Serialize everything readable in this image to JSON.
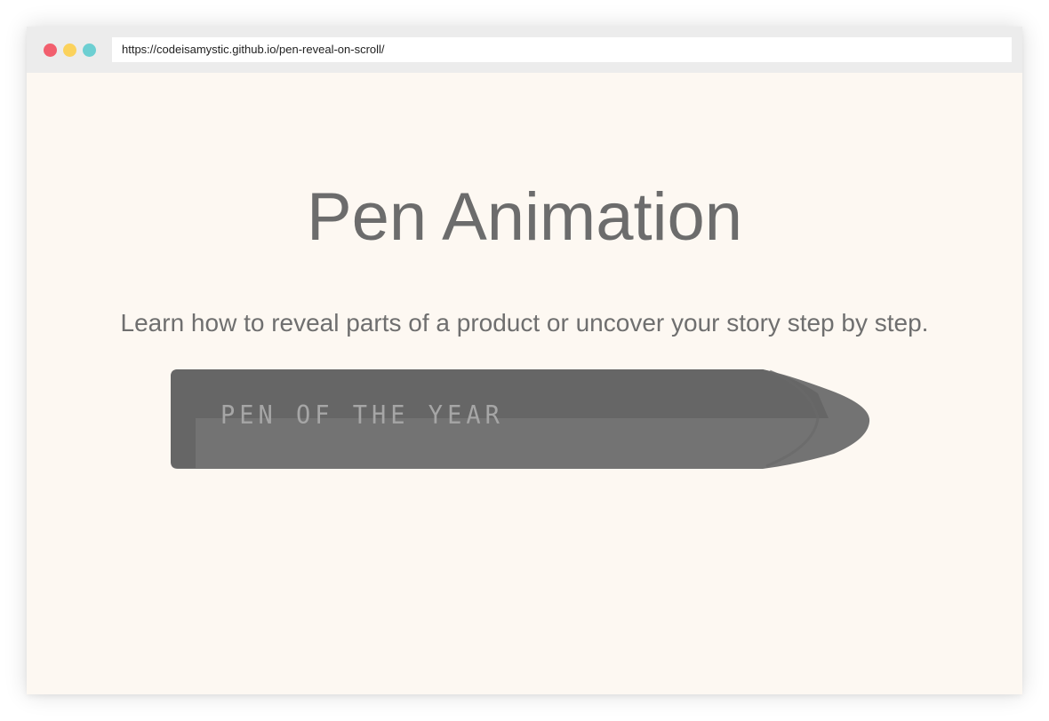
{
  "browser": {
    "url": "https://codeisamystic.github.io/pen-reveal-on-scroll/",
    "controls": {
      "close_color": "#f25f6e",
      "minimize_color": "#fbd25c",
      "maximize_color": "#6dcfd2"
    }
  },
  "page": {
    "title": "Pen Animation",
    "subtitle": "Learn how to reveal parts of a product or uncover your story step by step.",
    "pen": {
      "label": "PEN OF THE YEAR",
      "body_color": "#6a6a6a"
    }
  }
}
